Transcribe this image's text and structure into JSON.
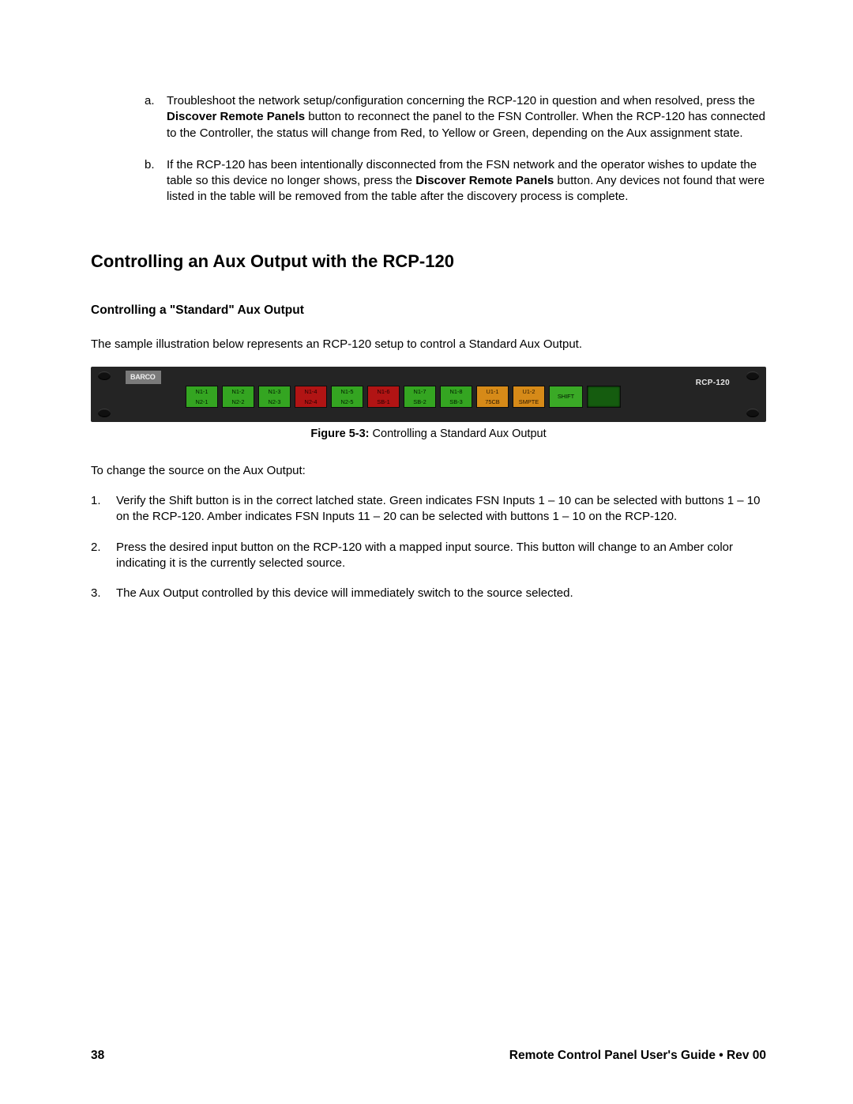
{
  "list_a": {
    "marker": "a.",
    "text_1": "Troubleshoot the network setup/configuration concerning the RCP-120 in question and when resolved, press the ",
    "bold_1": "Discover Remote Panels",
    "text_2": " button to reconnect the panel to the FSN Controller. When the RCP-120 has connected to the Controller, the status will change from Red, to Yellow or Green, depending on the Aux assignment state."
  },
  "list_b": {
    "marker": "b.",
    "text_1": "If the RCP-120 has been intentionally disconnected from the FSN network and the operator wishes to update the table so this device no longer shows, press the ",
    "bold_1": "Discover Remote Panels",
    "text_2": " button. Any devices not found that were listed in the table will be removed from the table after the discovery process is complete."
  },
  "heading_main": "Controlling an Aux Output with the RCP-120",
  "heading_sub": "Controlling a \"Standard\" Aux Output",
  "intro_para": "The sample illustration below represents an RCP-120 setup to control a Standard Aux Output.",
  "panel": {
    "logo": "BARCO",
    "model": "RCP-120",
    "buttons": [
      {
        "top": "N1-1",
        "bot": "N2-1",
        "topc": "green",
        "botc": "green"
      },
      {
        "top": "N1-2",
        "bot": "N2-2",
        "topc": "green",
        "botc": "green"
      },
      {
        "top": "N1-3",
        "bot": "N2-3",
        "topc": "green",
        "botc": "green"
      },
      {
        "top": "N1-4",
        "bot": "N2-4",
        "topc": "red",
        "botc": "red"
      },
      {
        "top": "N1-5",
        "bot": "N2-5",
        "topc": "green",
        "botc": "green"
      },
      {
        "top": "N1-6",
        "bot": "SB-1",
        "topc": "red",
        "botc": "red"
      },
      {
        "top": "N1-7",
        "bot": "SB-2",
        "topc": "green",
        "botc": "green"
      },
      {
        "top": "N1-8",
        "bot": "SB-3",
        "topc": "green",
        "botc": "green"
      },
      {
        "top": "U1-1",
        "bot": "75CB",
        "topc": "amber",
        "botc": "amber"
      },
      {
        "top": "U1-2",
        "bot": "SMPTE",
        "topc": "amber",
        "botc": "amber"
      }
    ],
    "shift": "SHIFT"
  },
  "figure_caption_label": "Figure 5-3:",
  "figure_caption_text": " Controlling a Standard Aux Output",
  "after_fig": "To change the source on the Aux Output:",
  "steps": [
    {
      "marker": "1.",
      "text": "Verify the Shift button is in the correct latched state. Green indicates FSN Inputs 1 – 10 can be selected with buttons 1 – 10 on the RCP-120. Amber indicates FSN Inputs 11 – 20 can be selected with buttons 1 – 10 on the RCP-120."
    },
    {
      "marker": "2.",
      "text": "Press the desired input button on the RCP-120 with a mapped input source. This button will change to an Amber color indicating it is the currently selected source."
    },
    {
      "marker": "3.",
      "text": "The Aux Output controlled by this device will immediately switch to the source selected."
    }
  ],
  "footer": {
    "page_num": "38",
    "title": "Remote Control Panel User's Guide • Rev 00"
  }
}
